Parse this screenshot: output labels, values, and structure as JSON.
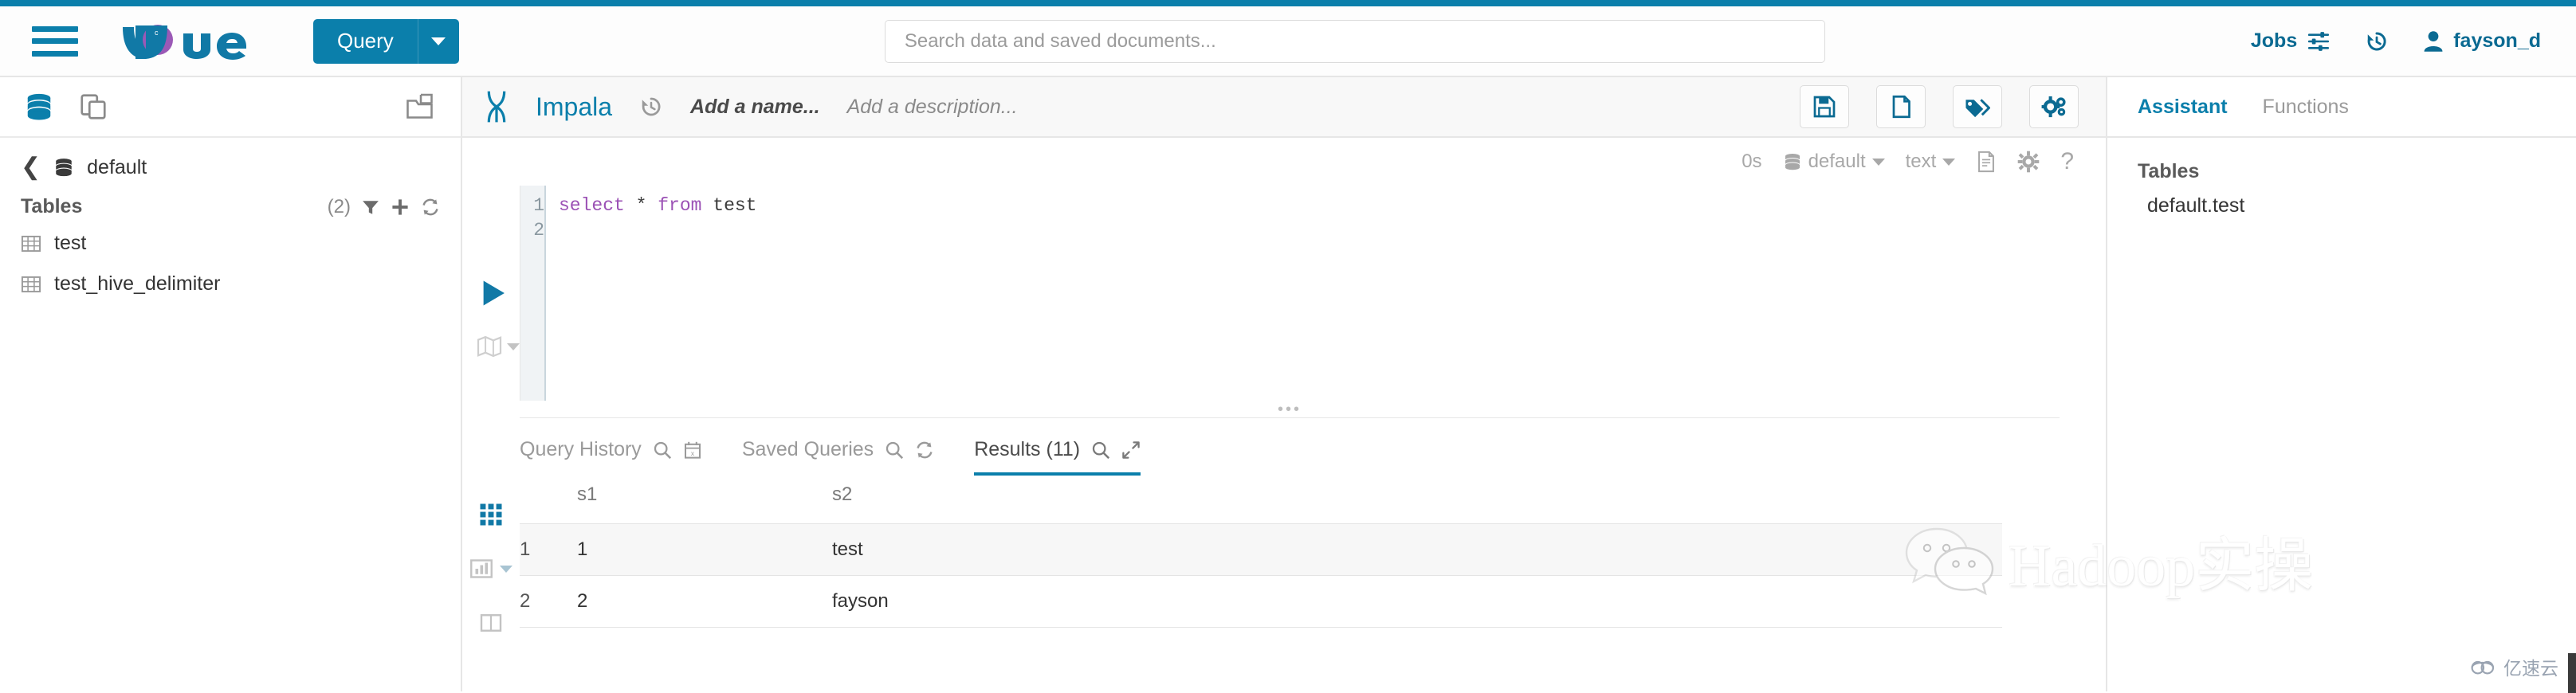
{
  "navbar": {
    "hamburger_icon": "hamburger-menu-icon",
    "logo_text": "Hue",
    "query_button": "Query",
    "query_caret_icon": "chevron-down-icon",
    "search": {
      "placeholder": "Search data and saved documents...",
      "value": ""
    },
    "jobs_label": "Jobs",
    "jobs_icon": "sliders-icon",
    "history_icon": "history-icon",
    "user_label": "fayson_d",
    "user_icon": "user-icon"
  },
  "sidebar": {
    "head_icons": [
      "database-icon",
      "documents-icon",
      "import-folder-icon"
    ],
    "breadcrumb": {
      "back_icon": "chevron-left-icon",
      "db_icon": "database-icon",
      "label": "default"
    },
    "section": {
      "title": "Tables",
      "count": "(2)",
      "icons": [
        "filter-icon",
        "plus-icon",
        "refresh-icon"
      ]
    },
    "tables": [
      {
        "icon": "table-icon",
        "label": "test"
      },
      {
        "icon": "table-icon",
        "label": "test_hive_delimiter"
      }
    ]
  },
  "editor": {
    "engine_icon": "impala-icon",
    "engine_name": "Impala",
    "history_icon": "history-icon",
    "name_placeholder": "Add a name...",
    "description_placeholder": "Add a description...",
    "actions": [
      {
        "icon": "save-icon",
        "name": "save-button"
      },
      {
        "icon": "new-document-icon",
        "name": "new-document-button"
      },
      {
        "icon": "tag-icon",
        "name": "tags-button"
      },
      {
        "icon": "gears-icon",
        "name": "settings-button"
      }
    ],
    "status_bar": {
      "elapsed": "0s",
      "database": "default",
      "database_icon": "database-icon",
      "format": "text",
      "doc_icon": "document-icon",
      "gear_icon": "gear-icon",
      "help_icon": "question-mark-icon"
    },
    "run_icon": "play-icon",
    "explain_icon": "map-icon",
    "line_numbers": [
      "1",
      "2"
    ],
    "sql": {
      "keyword1": "select",
      "star": " * ",
      "keyword2": "from",
      "table": " test"
    },
    "sql_full": "select * from test"
  },
  "result_tabs": [
    {
      "label": "Query History",
      "icons": [
        "search-icon",
        "calendar-clear-icon"
      ],
      "active": false
    },
    {
      "label": "Saved Queries",
      "icons": [
        "search-icon",
        "refresh-icon"
      ],
      "active": false
    },
    {
      "label": "Results (11)",
      "icons": [
        "search-icon",
        "expand-icon"
      ],
      "active": true
    }
  ],
  "result_view_icons": [
    {
      "name": "grid-view-icon",
      "active": true
    },
    {
      "name": "chart-view-icon",
      "active": false
    },
    {
      "name": "columns-view-icon",
      "active": false
    }
  ],
  "results": {
    "columns": [
      "",
      "s1",
      "s2"
    ],
    "rows": [
      {
        "num": "1",
        "s1": "1",
        "s2": "test"
      },
      {
        "num": "2",
        "s1": "2",
        "s2": "fayson"
      }
    ]
  },
  "assistant": {
    "tabs": [
      {
        "label": "Assistant",
        "active": true
      },
      {
        "label": "Functions",
        "active": false
      }
    ],
    "section_title": "Tables",
    "items": [
      "default.test"
    ]
  },
  "watermarks": {
    "wechat_text": "Hadoop实操",
    "wechat_icon": "wechat-icon",
    "corner_text": "亿速云",
    "corner_icon": "cloud-icon"
  },
  "colors": {
    "accent": "#0b7fab",
    "accent_dark": "#0b6a92",
    "logo_purple": "#9b59b6",
    "text": "#333333",
    "muted": "#9a9a9a",
    "border": "#e6e6e6"
  }
}
